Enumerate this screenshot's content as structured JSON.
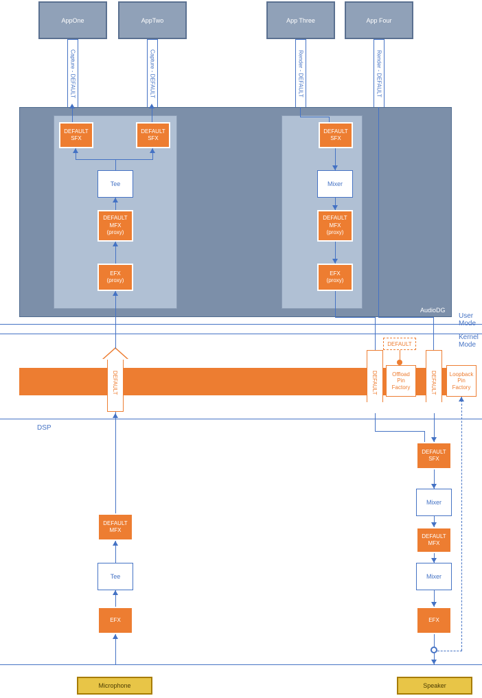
{
  "apps": {
    "one": "AppOne",
    "two": "AppTwo",
    "three": "App Three",
    "four": "App Four"
  },
  "pipes": {
    "captureDefault": "Capture - DEFAULT",
    "renderDefault": "Render - DEFAULT"
  },
  "boxes": {
    "defaultSfx": "DEFAULT\nSFX",
    "defaultMfx": "DEFAULT\nMFX",
    "defaultMfxProxy": "DEFAULT\nMFX\n(proxy)",
    "efx": "EFX",
    "efxProxy": "EFX\n(proxy)",
    "tee": "Tee",
    "mixer": "Mixer",
    "offloadPin": "Offload\nPin\nFactory",
    "loopbackPin": "Loopback\nPin\nFactory",
    "default": "DEFAULT"
  },
  "labels": {
    "audiodg": "AudioDG",
    "userMode": "User\nMode",
    "kernelMode": "Kernel\nMode",
    "dsp": "DSP"
  },
  "devices": {
    "mic": "Microphone",
    "speaker": "Speaker"
  }
}
